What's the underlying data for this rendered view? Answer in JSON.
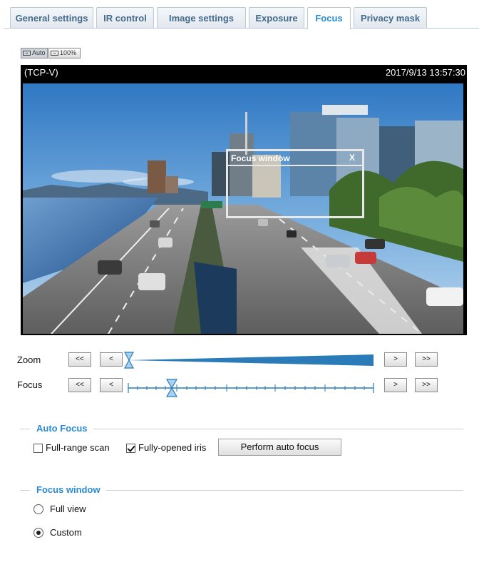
{
  "tabs": [
    {
      "label": "General settings",
      "active": false
    },
    {
      "label": "IR control",
      "active": false
    },
    {
      "label": "Image settings",
      "active": false
    },
    {
      "label": "Exposure",
      "active": false
    },
    {
      "label": "Focus",
      "active": true
    },
    {
      "label": "Privacy mask",
      "active": false
    }
  ],
  "view_buttons": {
    "auto": "Auto",
    "full": "100%"
  },
  "video": {
    "stream": "(TCP-V)",
    "timestamp": "2017/9/13 13:57:30",
    "focus_window_title": "Focus window",
    "focus_window_close": "X"
  },
  "zoom": {
    "label": "Zoom",
    "far_back": "<<",
    "back": "<",
    "forward": ">",
    "far_forward": ">>",
    "level": 0
  },
  "focus": {
    "label": "Focus",
    "far_back": "<<",
    "back": "<",
    "forward": ">",
    "far_forward": ">>",
    "level": 0.17
  },
  "auto_focus": {
    "legend": "Auto Focus",
    "full_range_scan": {
      "label": "Full-range scan",
      "checked": false
    },
    "fully_opened_iris": {
      "label": "Fully-opened iris",
      "checked": true
    },
    "perform_button": "Perform auto focus"
  },
  "focus_window": {
    "legend": "Focus window",
    "options": [
      {
        "label": "Full view",
        "selected": false
      },
      {
        "label": "Custom",
        "selected": true
      }
    ]
  },
  "colors": {
    "accent": "#2a8bd4",
    "tab_text": "#446a8c",
    "slider": "#2a7bb8"
  }
}
